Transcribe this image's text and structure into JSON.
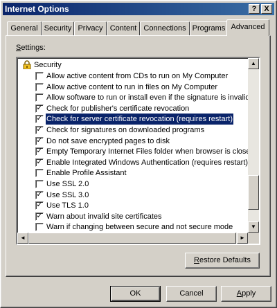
{
  "window": {
    "title": "Internet Options",
    "help": "?",
    "close": "X"
  },
  "tabs": [
    {
      "label": "General"
    },
    {
      "label": "Security"
    },
    {
      "label": "Privacy"
    },
    {
      "label": "Content"
    },
    {
      "label": "Connections"
    },
    {
      "label": "Programs"
    },
    {
      "label": "Advanced",
      "active": true
    }
  ],
  "settings": {
    "label_prefix": "",
    "label_accel": "S",
    "label_rest": "ettings:",
    "category": "Security",
    "items": [
      {
        "label": "Allow active content from CDs to run on My Computer",
        "checked": false
      },
      {
        "label": "Allow active content to run in files on My Computer",
        "checked": false
      },
      {
        "label": "Allow software to run or install even if the signature is invalid",
        "checked": false
      },
      {
        "label": "Check for publisher's certificate revocation",
        "checked": true
      },
      {
        "label": "Check for server certificate revocation (requires restart)",
        "checked": true,
        "selected": true
      },
      {
        "label": "Check for signatures on downloaded programs",
        "checked": true
      },
      {
        "label": "Do not save encrypted pages to disk",
        "checked": true
      },
      {
        "label": "Empty Temporary Internet Files folder when browser is closed",
        "checked": true
      },
      {
        "label": "Enable Integrated Windows Authentication (requires restart)",
        "checked": true
      },
      {
        "label": "Enable Profile Assistant",
        "checked": false
      },
      {
        "label": "Use SSL 2.0",
        "checked": false
      },
      {
        "label": "Use SSL 3.0",
        "checked": true
      },
      {
        "label": "Use TLS 1.0",
        "checked": true
      },
      {
        "label": "Warn about invalid site certificates",
        "checked": true
      },
      {
        "label": "Warn if changing between secure and not secure mode",
        "checked": false
      }
    ],
    "scroll_position": 0.9
  },
  "buttons": {
    "restore_accel": "R",
    "restore_rest": "estore Defaults",
    "ok": "OK",
    "cancel": "Cancel",
    "apply_accel": "A",
    "apply_rest": "pply"
  },
  "icons": {
    "category": "lock-icon",
    "check": "✓"
  },
  "colors": {
    "face": "#d4d0c8",
    "title_start": "#0a246a",
    "title_end": "#3a6ea5",
    "selection": "#0a246a"
  }
}
